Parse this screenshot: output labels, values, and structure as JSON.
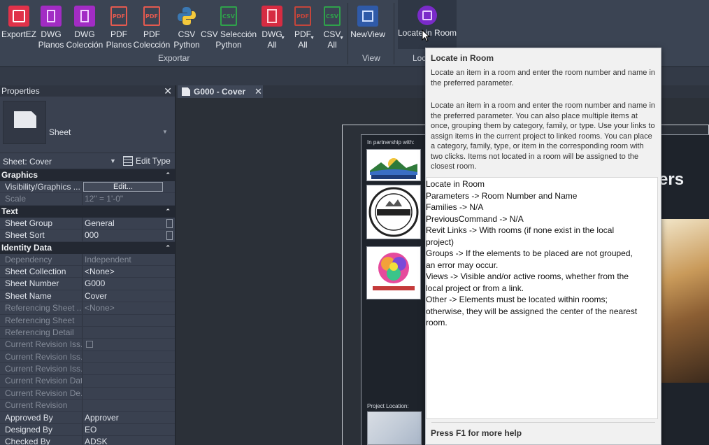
{
  "ribbon": {
    "buttons": [
      {
        "id": "exportez",
        "label": "ExportEZ",
        "icon": "exportez-icon"
      },
      {
        "id": "dwg-planos",
        "label": "DWG\nPlanos",
        "icon": "dwg-planos-icon"
      },
      {
        "id": "dwg-coleccion",
        "label": "DWG\nColección",
        "icon": "dwg-collection-icon"
      },
      {
        "id": "pdf-planos",
        "label": "PDF\nPlanos",
        "icon": "pdf-planos-icon"
      },
      {
        "id": "pdf-coleccion",
        "label": "PDF\nColección",
        "icon": "pdf-collection-icon"
      },
      {
        "id": "csv-python",
        "label": "CSV\nPython",
        "icon": "python-icon"
      },
      {
        "id": "csv-seleccion",
        "label": "CSV Selección\nPython",
        "icon": "csv-selection-icon"
      },
      {
        "id": "dwg-all",
        "label": "DWG\nAll",
        "icon": "dwg-all-icon"
      },
      {
        "id": "pdf-all",
        "label": "PDF\nAll",
        "icon": "pdf-all-icon"
      },
      {
        "id": "csv-all",
        "label": "CSV\nAll",
        "icon": "csv-all-icon"
      },
      {
        "id": "newview",
        "label": "NewView",
        "icon": "new-view-icon"
      },
      {
        "id": "locate",
        "label": "Locate in Room",
        "icon": "locate-room-icon"
      }
    ],
    "groups": {
      "exportar": "Exportar",
      "view": "View",
      "locate": "Loc"
    },
    "doc_labels": {
      "pdf": "PDF",
      "csv": "CSV",
      "dwg": "DWG"
    }
  },
  "properties": {
    "title": "Properties",
    "type_name": "Sheet",
    "selector": "Sheet: Cover",
    "edit_type": "Edit Type",
    "sections": [
      {
        "title": "Graphics",
        "rows": [
          {
            "k": "Visibility/Graphics ...",
            "v": "Edit...",
            "button": true
          },
          {
            "k": "Scale",
            "v": "12\" = 1'-0\"",
            "dim": true
          }
        ]
      },
      {
        "title": "Text",
        "rows": [
          {
            "k": "Sheet Group",
            "v": "General",
            "box": true
          },
          {
            "k": "Sheet Sort",
            "v": "000",
            "box": true
          }
        ]
      },
      {
        "title": "Identity Data",
        "rows": [
          {
            "k": "Dependency",
            "v": "Independent",
            "dim": true
          },
          {
            "k": "Sheet Collection",
            "v": "<None>"
          },
          {
            "k": "Sheet Number",
            "v": "G000"
          },
          {
            "k": "Sheet Name",
            "v": "Cover"
          },
          {
            "k": "Referencing Sheet ...",
            "v": "<None>",
            "dim": true
          },
          {
            "k": "Referencing Sheet",
            "v": "",
            "dim": true
          },
          {
            "k": "Referencing Detail",
            "v": "",
            "dim": true
          },
          {
            "k": "Current Revision Iss...",
            "v": "",
            "dim": true,
            "checkbox": true
          },
          {
            "k": "Current Revision Iss...",
            "v": "",
            "dim": true
          },
          {
            "k": "Current Revision Iss...",
            "v": "",
            "dim": true
          },
          {
            "k": "Current Revision Date",
            "v": "",
            "dim": true
          },
          {
            "k": "Current Revision De...",
            "v": "",
            "dim": true
          },
          {
            "k": "Current Revision",
            "v": "",
            "dim": true
          },
          {
            "k": "Approved By",
            "v": "Approver"
          },
          {
            "k": "Designed By",
            "v": "EO"
          },
          {
            "k": "Checked By",
            "v": "ADSK"
          }
        ]
      }
    ]
  },
  "tabs": [
    {
      "label": "G000 - Cover",
      "active": true
    }
  ],
  "canvas": {
    "partnership_label": "In partnership with:",
    "project_location_label": "Project Location:",
    "partial_title": "ers"
  },
  "tooltip": {
    "title": "Locate in Room",
    "short_desc": "Locate an item in a room and enter the room number and name in the preferred parameter.",
    "long_desc": "Locate an item in a room and enter the room number and name in the preferred parameter. You can also place multiple items at once, grouping them by category, family, or type. Use your links to assign items in the current project to linked rooms. You can place a category, family, type, or item in the corresponding room with two clicks. Items not located in a room will be assigned to the closest room.",
    "details": "Locate in Room\nParameters -> Room Number and Name\nFamilies -> N/A\nPreviousCommand -> N/A\nRevit Links -> With rooms (if none exist in the local\nproject)\nGroups -> If the elements to be placed are not grouped,\nan error may occur.\nViews -> Visible and/or active rooms, whether from the\nlocal project or from a link.\nOther -> Elements must be located within rooms;\notherwise, they will be assigned the center of the nearest\nroom.",
    "footer": "Press F1 for more help"
  },
  "colors": {
    "ribbon_bg": "#3b4453",
    "panel_bg": "#3a4150",
    "section_bg": "#232832",
    "tooltip_bg": "#f1f1f1"
  }
}
